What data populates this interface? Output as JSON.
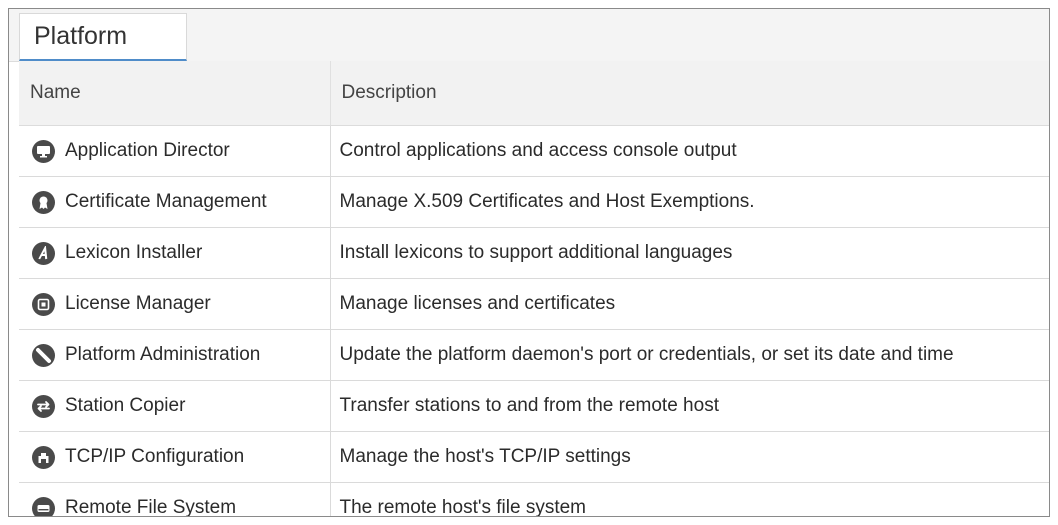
{
  "tab": {
    "label": "Platform"
  },
  "table": {
    "headers": {
      "name": "Name",
      "description": "Description"
    },
    "rows": [
      {
        "name": "Application Director",
        "description": "Control applications and access console output",
        "icon": "monitor-icon"
      },
      {
        "name": "Certificate Management",
        "description": "Manage X.509 Certificates and Host Exemptions.",
        "icon": "certificate-icon"
      },
      {
        "name": "Lexicon Installer",
        "description": "Install lexicons to support additional languages",
        "icon": "lexicon-icon"
      },
      {
        "name": "License Manager",
        "description": "Manage licenses and certificates",
        "icon": "license-icon"
      },
      {
        "name": "Platform Administration",
        "description": "Update the platform daemon's port or credentials, or set its date and time",
        "icon": "wrench-icon"
      },
      {
        "name": "Station Copier",
        "description": "Transfer stations to and from the remote host",
        "icon": "transfer-icon"
      },
      {
        "name": "TCP/IP Configuration",
        "description": "Manage the host's TCP/IP settings",
        "icon": "network-port-icon"
      },
      {
        "name": "Remote File System",
        "description": "The remote host's file system",
        "icon": "drive-icon"
      }
    ]
  }
}
